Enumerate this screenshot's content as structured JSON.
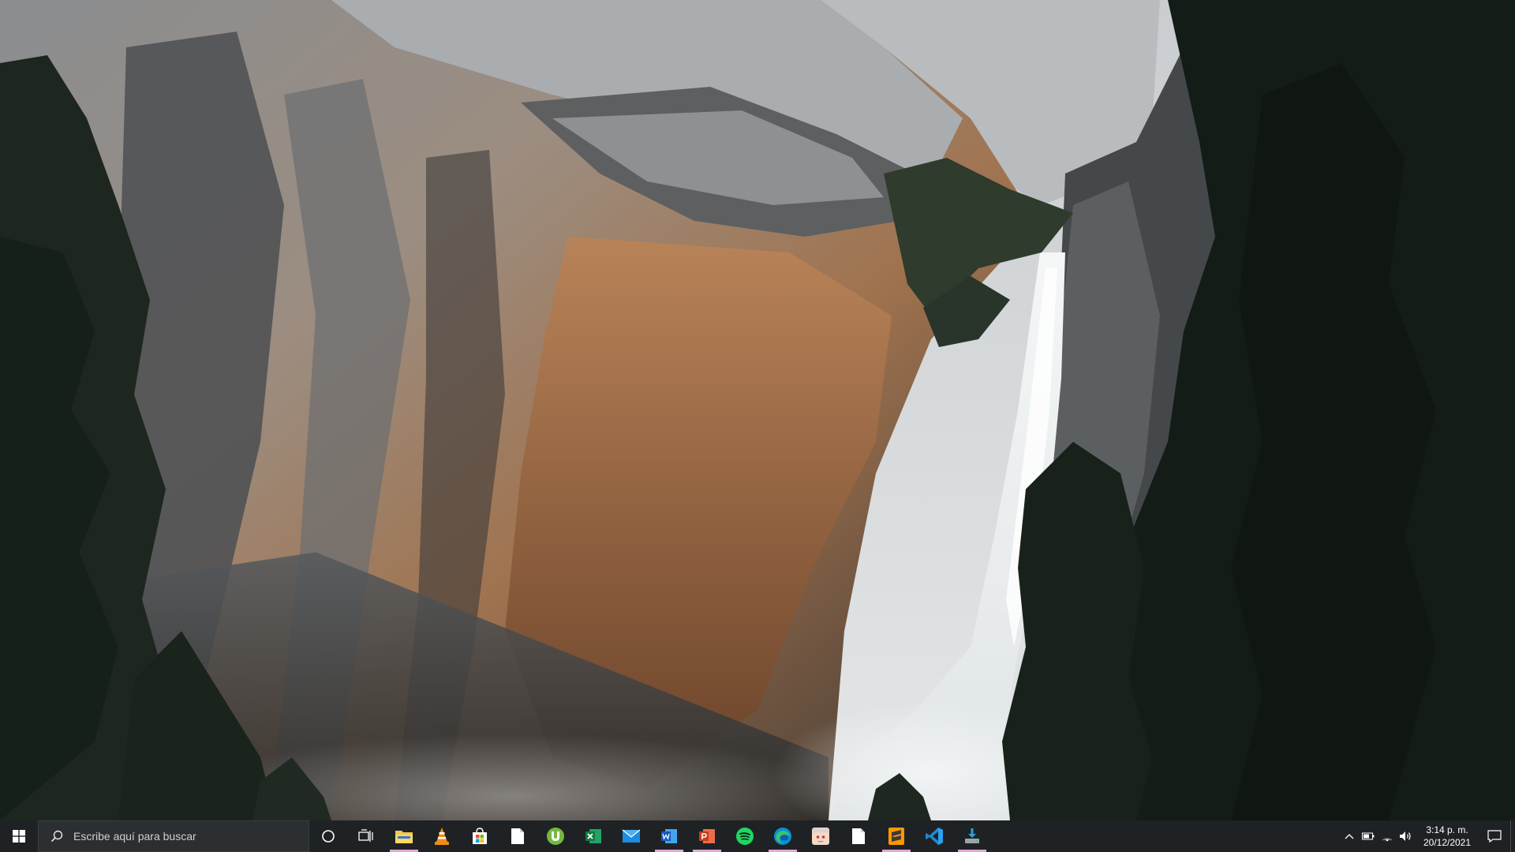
{
  "wallpaper": {
    "description_icon": "landscape-wallpaper"
  },
  "taskbar": {
    "search": {
      "placeholder": "Escribe aquí para buscar"
    },
    "apps": [
      {
        "name": "cortana",
        "icon": "circle-icon"
      },
      {
        "name": "task-view",
        "icon": "task-view-icon"
      },
      {
        "name": "file-explorer",
        "icon": "folder-icon",
        "running": true,
        "indicator": "#e0a8d8"
      },
      {
        "name": "vlc",
        "icon": "vlc-cone-icon"
      },
      {
        "name": "microsoft-store",
        "icon": "store-bag-icon"
      },
      {
        "name": "document",
        "icon": "blank-document-icon"
      },
      {
        "name": "utorrent",
        "icon": "utorrent-icon"
      },
      {
        "name": "excel",
        "icon": "excel-icon"
      },
      {
        "name": "mail",
        "icon": "mail-icon"
      },
      {
        "name": "word",
        "icon": "word-icon",
        "running": true,
        "indicator": "#e0a8d8"
      },
      {
        "name": "powerpoint",
        "icon": "powerpoint-icon",
        "running": true,
        "indicator": "#e0a8d8"
      },
      {
        "name": "spotify",
        "icon": "spotify-icon"
      },
      {
        "name": "edge",
        "icon": "edge-icon",
        "running": true,
        "indicator": "#e0a8d8"
      },
      {
        "name": "anime-app",
        "icon": "character-avatar-icon"
      },
      {
        "name": "document-2",
        "icon": "blank-document-icon"
      },
      {
        "name": "sublime-text",
        "icon": "sublime-text-icon",
        "running": true,
        "indicator": "#e0a8d8"
      },
      {
        "name": "vscode",
        "icon": "vscode-icon"
      },
      {
        "name": "installer",
        "icon": "installer-icon",
        "running": true,
        "indicator": "#e0a8d8"
      }
    ],
    "tray": {
      "icons": [
        "chevron-up-icon",
        "battery-icon",
        "wifi-icon",
        "volume-icon"
      ],
      "time": "3:14 p. m.",
      "date": "20/12/2021"
    }
  },
  "colors": {
    "taskbar_bg": "#1f2224",
    "accent_indicator": "#e0a8d8"
  }
}
